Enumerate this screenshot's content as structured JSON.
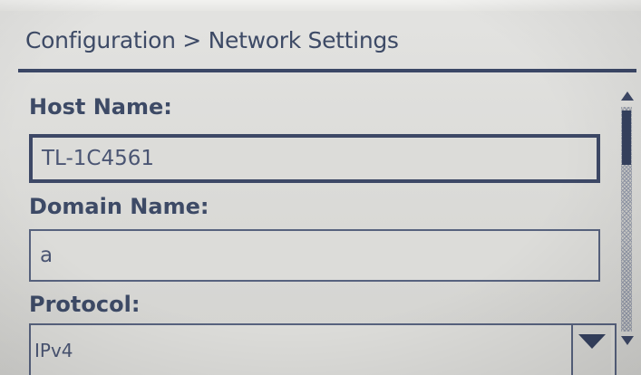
{
  "header": {
    "breadcrumb": "Configuration > Network Settings"
  },
  "form": {
    "host_name": {
      "label": "Host Name:",
      "value": "TL-1C4561"
    },
    "domain_name": {
      "label": "Domain Name:",
      "value": "a"
    },
    "protocol": {
      "label": "Protocol:",
      "value": "IPv4"
    }
  },
  "icons": {
    "scroll_up": "triangle-up-icon",
    "scroll_down": "triangle-down-icon",
    "dropdown": "triangle-down-icon"
  },
  "colors": {
    "text": "#3d4a66",
    "border": "#3d4866",
    "background": "#dadad7"
  }
}
